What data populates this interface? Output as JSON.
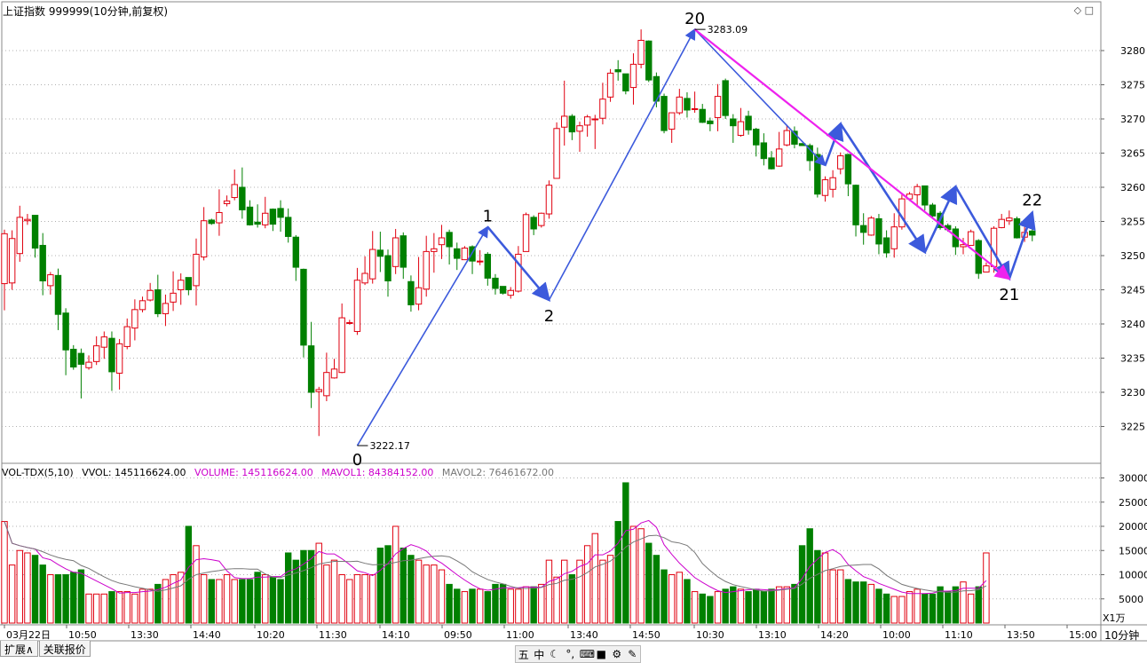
{
  "header": {
    "title": "上证指数 999999(10分钟,前复权)"
  },
  "window_icons": {
    "restore": "◇",
    "maximize": "□"
  },
  "price_panel": {
    "ylim": [
      3220,
      3285
    ],
    "y_ticks": [
      "3280",
      "3275",
      "3270",
      "3265",
      "3260",
      "3255",
      "3250",
      "3245",
      "3240",
      "3235",
      "3230",
      "3225"
    ],
    "high_marker": "3283.09",
    "low_marker": "3222.17",
    "wave_labels": [
      "0",
      "1",
      "2",
      "20",
      "21",
      "22"
    ]
  },
  "volume_panel": {
    "label": "VOL-TDX(5,10)",
    "vvol": "VVOL: 145116624.00",
    "volume": "VOLUME: 145116624.00",
    "mavol1": "MAVOL1: 84384152.00",
    "mavol2": "MAVOL2: 76461672.00",
    "y_ticks": [
      "30000",
      "25000",
      "20000",
      "15000",
      "10000",
      "5000"
    ],
    "unit": "X1万"
  },
  "x_axis": {
    "labels": [
      "03月22日",
      "10:50",
      "13:30",
      "14:40",
      "10:20",
      "11:30",
      "14:10",
      "09:50",
      "11:00",
      "13:40",
      "14:50",
      "10:30",
      "13:10",
      "14:20",
      "10:00",
      "11:10",
      "13:50",
      "15:00"
    ],
    "period": "10分钟"
  },
  "tabs": [
    "扩展∧",
    "关联报价"
  ],
  "bottombar": [
    "五",
    "中",
    "☾",
    "°,",
    "⌨",
    "■",
    "⚙",
    "✎"
  ],
  "colors": {
    "up": "#e0000f",
    "down": "#008000",
    "wave": "#3c5adc",
    "wave2": "#ee22ee",
    "ma1": "#cc00cc",
    "ma2": "#777777"
  },
  "chart_data": {
    "type": "candlestick",
    "y_range": [
      3220,
      3285
    ],
    "candles": [
      [
        3245.9,
        3253.2,
        3242,
        3253.8
      ],
      [
        3246,
        3252.5,
        3245,
        3253.7
      ],
      [
        3250.3,
        3255.6,
        3249.1,
        3257.3
      ],
      [
        3255.1,
        3255.3,
        3254.5,
        3256.1
      ],
      [
        3255.9,
        3251.1,
        3249.7,
        3255.9
      ],
      [
        3251.5,
        3246.3,
        3244.2,
        3253.3
      ],
      [
        3245.6,
        3247.2,
        3244.3,
        3247.6
      ],
      [
        3247.1,
        3241.4,
        3239.1,
        3248.1
      ],
      [
        3241.6,
        3236.2,
        3232.5,
        3242.3
      ],
      [
        3236.3,
        3233.7,
        3233.3,
        3236.9
      ],
      [
        3235.7,
        3234.1,
        3229.1,
        3236.4
      ],
      [
        3233.6,
        3234.4,
        3233.3,
        3235.4
      ],
      [
        3234.5,
        3236.8,
        3234,
        3238.2
      ],
      [
        3236.6,
        3238.1,
        3234.9,
        3238.9
      ],
      [
        3237.9,
        3233,
        3230.2,
        3238.9
      ],
      [
        3232.8,
        3237.1,
        3230.4,
        3237.8
      ],
      [
        3236.7,
        3239.6,
        3236.3,
        3240.8
      ],
      [
        3239.4,
        3242.1,
        3237.6,
        3243.6
      ],
      [
        3242.1,
        3243.4,
        3241.7,
        3244
      ],
      [
        3243.5,
        3244.9,
        3243.3,
        3246
      ],
      [
        3245,
        3241.5,
        3241,
        3247.2
      ],
      [
        3241.5,
        3243,
        3239.7,
        3244.3
      ],
      [
        3243.2,
        3244.5,
        3241.9,
        3247.7
      ],
      [
        3245,
        3246.4,
        3242.8,
        3247.4
      ],
      [
        3246.8,
        3245,
        3244.2,
        3246.8
      ],
      [
        3245.6,
        3250.2,
        3242.7,
        3252.5
      ],
      [
        3249.8,
        3255.1,
        3249.3,
        3257.1
      ],
      [
        3255.2,
        3254.7,
        3254.5,
        3255.4
      ],
      [
        3254.8,
        3256.3,
        3252.9,
        3259.7
      ],
      [
        3257.6,
        3258,
        3257.2,
        3258.8
      ],
      [
        3258.5,
        3260.4,
        3258.1,
        3262.6
      ],
      [
        3260,
        3256.7,
        3255.4,
        3262.9
      ],
      [
        3257.1,
        3254.5,
        3254.4,
        3258.1
      ],
      [
        3254.9,
        3254.6,
        3254.1,
        3257.5
      ],
      [
        3254.5,
        3256.2,
        3254,
        3258.6
      ],
      [
        3256.8,
        3254.6,
        3253.6,
        3256.9
      ],
      [
        3256.9,
        3255.6,
        3253.5,
        3258.1
      ],
      [
        3255.6,
        3252.8,
        3251.9,
        3256.9
      ],
      [
        3252.7,
        3248.3,
        3246.3,
        3253
      ],
      [
        3248,
        3236.9,
        3235.1,
        3248.1
      ],
      [
        3236.8,
        3230,
        3227.7,
        3240.3
      ],
      [
        3230.1,
        3230.4,
        3223.6,
        3230.8
      ],
      [
        3229.5,
        3232.9,
        3228.7,
        3235.8
      ],
      [
        3232.1,
        3233.4,
        3232,
        3234.9
      ],
      [
        3232.9,
        3240.9,
        3232.8,
        3243
      ],
      [
        3240.2,
        3240.2,
        3239.9,
        3240.6
      ],
      [
        3238.9,
        3246.4,
        3238.4,
        3248.2
      ],
      [
        3246,
        3247.4,
        3245.7,
        3249.9
      ],
      [
        3246.6,
        3250.9,
        3245.9,
        3253.6
      ],
      [
        3250.8,
        3249.9,
        3247.6,
        3253.5
      ],
      [
        3250,
        3246.3,
        3244,
        3250.9
      ],
      [
        3248.4,
        3252.6,
        3247.3,
        3253.9
      ],
      [
        3252.9,
        3248.3,
        3246.6,
        3253.4
      ],
      [
        3246.2,
        3242.8,
        3241.8,
        3247.1
      ],
      [
        3242.9,
        3245.3,
        3242,
        3249.8
      ],
      [
        3245.1,
        3250.6,
        3244,
        3252.9
      ],
      [
        3250.6,
        3251,
        3247.5,
        3253.3
      ],
      [
        3251.6,
        3252.6,
        3249.5,
        3254.5
      ],
      [
        3253.4,
        3251.3,
        3248.7,
        3253.8
      ],
      [
        3251,
        3249.6,
        3247.9,
        3251.9
      ],
      [
        3249.4,
        3251.1,
        3249.4,
        3251.4
      ],
      [
        3251.3,
        3249.2,
        3247.3,
        3251.5
      ],
      [
        3249.1,
        3249.2,
        3248.6,
        3250.8
      ],
      [
        3250.2,
        3246.7,
        3245.6,
        3250.5
      ],
      [
        3246.7,
        3245.2,
        3244.3,
        3247.3
      ],
      [
        3245.5,
        3244.5,
        3244.3,
        3245.5
      ],
      [
        3244.2,
        3244.9,
        3243.7,
        3245.4
      ],
      [
        3244.8,
        3250.2,
        3244.6,
        3251.4
      ],
      [
        3250.6,
        3256,
        3250.6,
        3256.3
      ],
      [
        3255.6,
        3253.9,
        3253,
        3255.9
      ],
      [
        3254.4,
        3256.2,
        3254.1,
        3256.3
      ],
      [
        3256.1,
        3260.3,
        3255.4,
        3261
      ],
      [
        3261.3,
        3268.6,
        3261.3,
        3269.5
      ],
      [
        3268.8,
        3270.4,
        3266.1,
        3275.6
      ],
      [
        3270.4,
        3268.1,
        3266.9,
        3270.7
      ],
      [
        3268.2,
        3269,
        3265.2,
        3269.6
      ],
      [
        3269.1,
        3270.3,
        3267.4,
        3270.6
      ],
      [
        3270,
        3270,
        3265.6,
        3270.6
      ],
      [
        3270.1,
        3272.9,
        3269.2,
        3275.3
      ],
      [
        3273.2,
        3276.7,
        3272.5,
        3277.3
      ],
      [
        3277.2,
        3276.9,
        3275.6,
        3278.6
      ],
      [
        3276.6,
        3274.1,
        3273.6,
        3276.6
      ],
      [
        3274.6,
        3278,
        3272.1,
        3279.6
      ],
      [
        3278,
        3281.5,
        3277.4,
        3283.1
      ],
      [
        3281.4,
        3275.7,
        3275.4,
        3281.5
      ],
      [
        3276.2,
        3272.6,
        3271.7,
        3276.8
      ],
      [
        3273.3,
        3268.3,
        3267.9,
        3273.7
      ],
      [
        3268.5,
        3270.9,
        3266.5,
        3270.9
      ],
      [
        3270.9,
        3273.2,
        3270.6,
        3274.4
      ],
      [
        3273,
        3271.3,
        3270.2,
        3273.9
      ],
      [
        3271.5,
        3271.5,
        3270.9,
        3274
      ],
      [
        3271.4,
        3269.5,
        3269.4,
        3272.2
      ],
      [
        3269.7,
        3269.3,
        3268.2,
        3270.2
      ],
      [
        3270.2,
        3273.3,
        3268.2,
        3275.1
      ],
      [
        3275.6,
        3270.5,
        3270,
        3275.9
      ],
      [
        3270,
        3269,
        3266.5,
        3270.7
      ],
      [
        3267.6,
        3269.6,
        3267.4,
        3271.6
      ],
      [
        3270.4,
        3268.4,
        3267.7,
        3271.2
      ],
      [
        3268.5,
        3266.2,
        3264.5,
        3268.7
      ],
      [
        3266.5,
        3264.2,
        3263.2,
        3267.9
      ],
      [
        3264.3,
        3262.7,
        3262.6,
        3265.3
      ],
      [
        3263.1,
        3265.6,
        3263,
        3268.1
      ],
      [
        3266.2,
        3268.3,
        3266,
        3269.1
      ],
      [
        3268.2,
        3266.3,
        3265.7,
        3268.9
      ],
      [
        3266.4,
        3266.1,
        3266.1,
        3266.4
      ],
      [
        3266.1,
        3263.9,
        3262.4,
        3266.4
      ],
      [
        3264.8,
        3259,
        3258.5,
        3265.8
      ],
      [
        3258.8,
        3261.1,
        3257.9,
        3261.6
      ],
      [
        3259.7,
        3261.4,
        3258.5,
        3262.5
      ],
      [
        3262.7,
        3264.6,
        3261.9,
        3265.1
      ],
      [
        3264.8,
        3260.5,
        3258.7,
        3264.9
      ],
      [
        3260.3,
        3254.5,
        3252.8,
        3260.4
      ],
      [
        3254.4,
        3253.4,
        3251.6,
        3256.2
      ],
      [
        3253,
        3255.5,
        3252.9,
        3255.8
      ],
      [
        3255.4,
        3251.7,
        3250.2,
        3256.1
      ],
      [
        3252.6,
        3250.4,
        3249.7,
        3253.7
      ],
      [
        3251,
        3254.2,
        3249.7,
        3256.2
      ],
      [
        3254.2,
        3258.3,
        3253.8,
        3258.9
      ],
      [
        3258.3,
        3259,
        3258,
        3259.3
      ],
      [
        3258.9,
        3260.1,
        3257.1,
        3260.5
      ],
      [
        3260.2,
        3257.4,
        3256.6,
        3260.2
      ],
      [
        3257.4,
        3255.8,
        3255.4,
        3257.7
      ],
      [
        3256.2,
        3254.1,
        3253.8,
        3256.5
      ],
      [
        3254.4,
        3253.8,
        3253.5,
        3254.7
      ],
      [
        3253.9,
        3251.3,
        3250.1,
        3254.3
      ],
      [
        3251.3,
        3251.6,
        3250.2,
        3252.6
      ],
      [
        3251.5,
        3253.5,
        3252.2,
        3253.8
      ],
      [
        3252.2,
        3247.4,
        3246.6,
        3252.4
      ],
      [
        3247.6,
        3248.5,
        3247.8,
        3249
      ],
      [
        3248.4,
        3254,
        3247.5,
        3254.3
      ],
      [
        3254.1,
        3255.3,
        3254,
        3256.1
      ],
      [
        3255.1,
        3255.5,
        3254.5,
        3256.6
      ],
      [
        3255.4,
        3252.6,
        3252.5,
        3255.7
      ],
      [
        3252.7,
        3253.4,
        3252,
        3254.2
      ],
      [
        3253.6,
        3253,
        3252.1,
        3254.4
      ]
    ],
    "volume_wan": [
      21000,
      12000,
      15000,
      14500,
      14000,
      12000,
      10000,
      10000,
      10000,
      10500,
      11000,
      6000,
      6000,
      6000,
      6500,
      6500,
      6500,
      6000,
      7000,
      7000,
      8000,
      9000,
      10000,
      10500,
      20000,
      16000,
      10000,
      9000,
      9000,
      10000,
      9000,
      9000,
      9000,
      10500,
      10000,
      9500,
      9000,
      14500,
      13000,
      15000,
      15000,
      16500,
      12000,
      13000,
      10000,
      9000,
      10000,
      10000,
      10000,
      15500,
      16000,
      20000,
      15500,
      14000,
      13000,
      12000,
      12000,
      11000,
      8000,
      7000,
      6500,
      7000,
      7000,
      6500,
      8000,
      8000,
      7000,
      7000,
      7500,
      7500,
      8000,
      13000,
      9500,
      13000,
      10000,
      13000,
      16000,
      18500,
      13000,
      14000,
      21000,
      29000,
      20000,
      19500,
      16500,
      14000,
      11000,
      10000,
      10500,
      9000,
      6500,
      6000,
      5500,
      6500,
      7000,
      7500,
      7000,
      6500,
      7000,
      6500,
      7000,
      7500,
      7500,
      8000,
      16000,
      19500,
      15000,
      14500,
      11000,
      11000,
      9000,
      8500,
      8500,
      8000,
      7000,
      6000,
      5500,
      5500,
      6500,
      7000,
      6000,
      6000,
      7500,
      6500,
      7500,
      8500,
      6000,
      7500,
      14500
    ]
  }
}
